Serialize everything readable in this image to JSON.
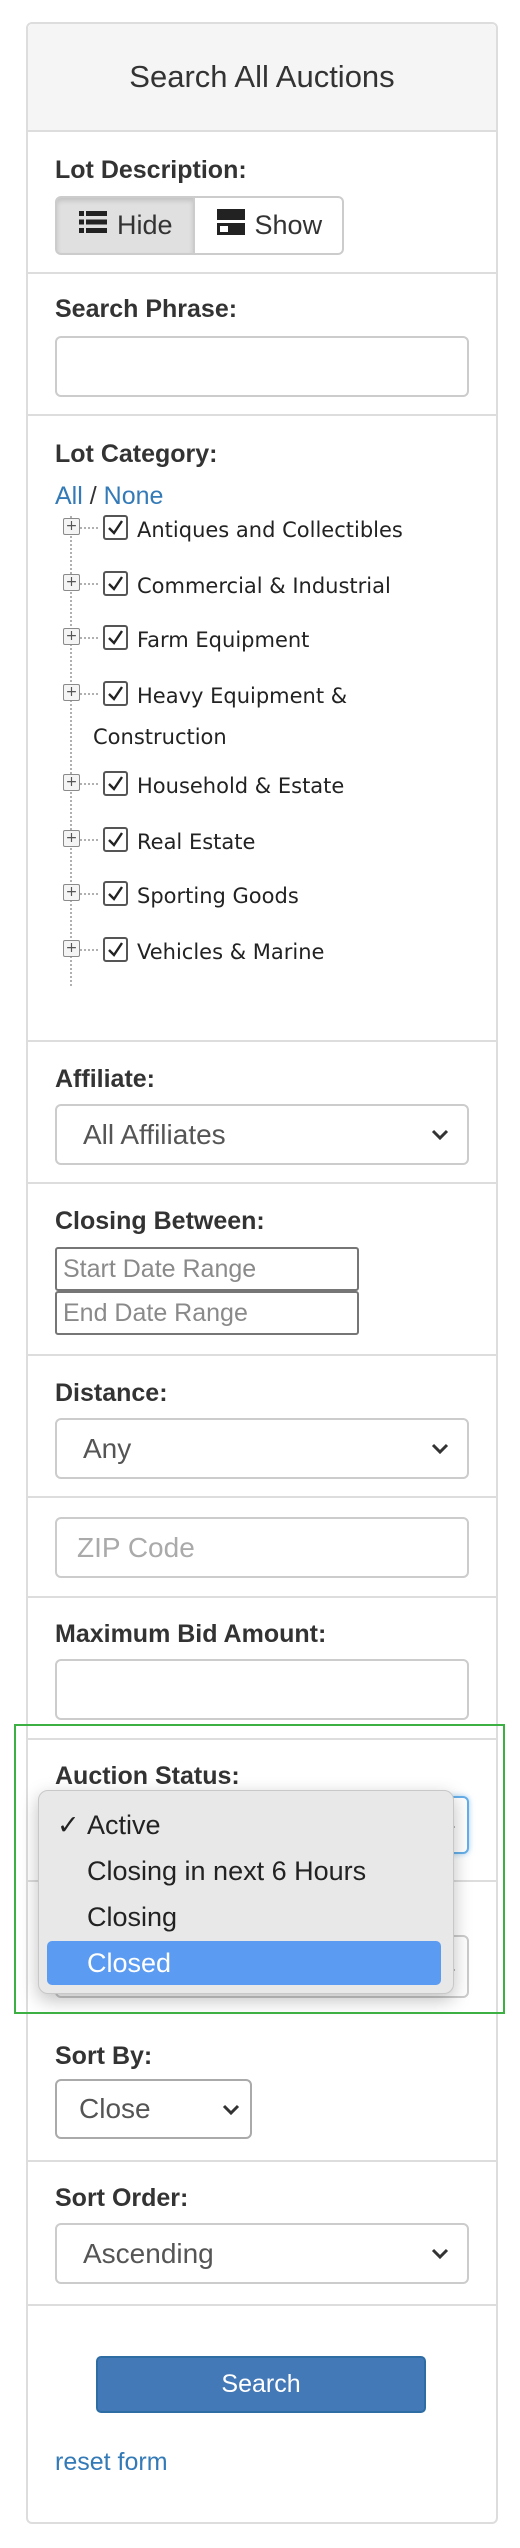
{
  "header": {
    "title": "Search All Auctions"
  },
  "lot_description": {
    "label": "Lot Description:",
    "hide_label": "Hide",
    "show_label": "Show",
    "hide_icon": "list-icon",
    "show_icon": "card-icon"
  },
  "search_phrase": {
    "label": "Search Phrase:",
    "value": ""
  },
  "lot_category": {
    "label": "Lot Category:",
    "all_link": "All",
    "separator": "/",
    "none_link": "None",
    "items": [
      {
        "label": "Antiques and Collectibles",
        "checked": true
      },
      {
        "label": "Commercial & Industrial",
        "checked": true
      },
      {
        "label": "Farm Equipment",
        "checked": true
      },
      {
        "label": "Heavy Equipment &",
        "label_line2": "Construction",
        "checked": true
      },
      {
        "label": "Household & Estate",
        "checked": true
      },
      {
        "label": "Real Estate",
        "checked": true
      },
      {
        "label": "Sporting Goods",
        "checked": true
      },
      {
        "label": "Vehicles & Marine",
        "checked": true
      }
    ]
  },
  "affiliate": {
    "label": "Affiliate:",
    "selected": "All Affiliates"
  },
  "closing_between": {
    "label": "Closing Between:",
    "start_placeholder": "Start Date Range",
    "end_placeholder": "End Date Range"
  },
  "distance": {
    "label": "Distance:",
    "selected": "Any",
    "zip_placeholder": "ZIP Code"
  },
  "max_bid": {
    "label": "Maximum Bid Amount:",
    "value": ""
  },
  "auction_status": {
    "label": "Auction Status:",
    "check_mark": "✓",
    "options": [
      "Active",
      "Closing in next 6 Hours",
      "Closing",
      "Closed"
    ],
    "checked_option": "Active",
    "highlighted_option": "Closed"
  },
  "sort_by": {
    "label": "Sort By:",
    "selected": "Close"
  },
  "sort_order": {
    "label": "Sort Order:",
    "selected": "Ascending"
  },
  "actions": {
    "search_label": "Search",
    "reset_label": "reset form"
  },
  "colors": {
    "link": "#337ab7",
    "primary_button": "#4479b8",
    "highlight": "#5b9bf1",
    "annotation_box": "#3cb043"
  }
}
